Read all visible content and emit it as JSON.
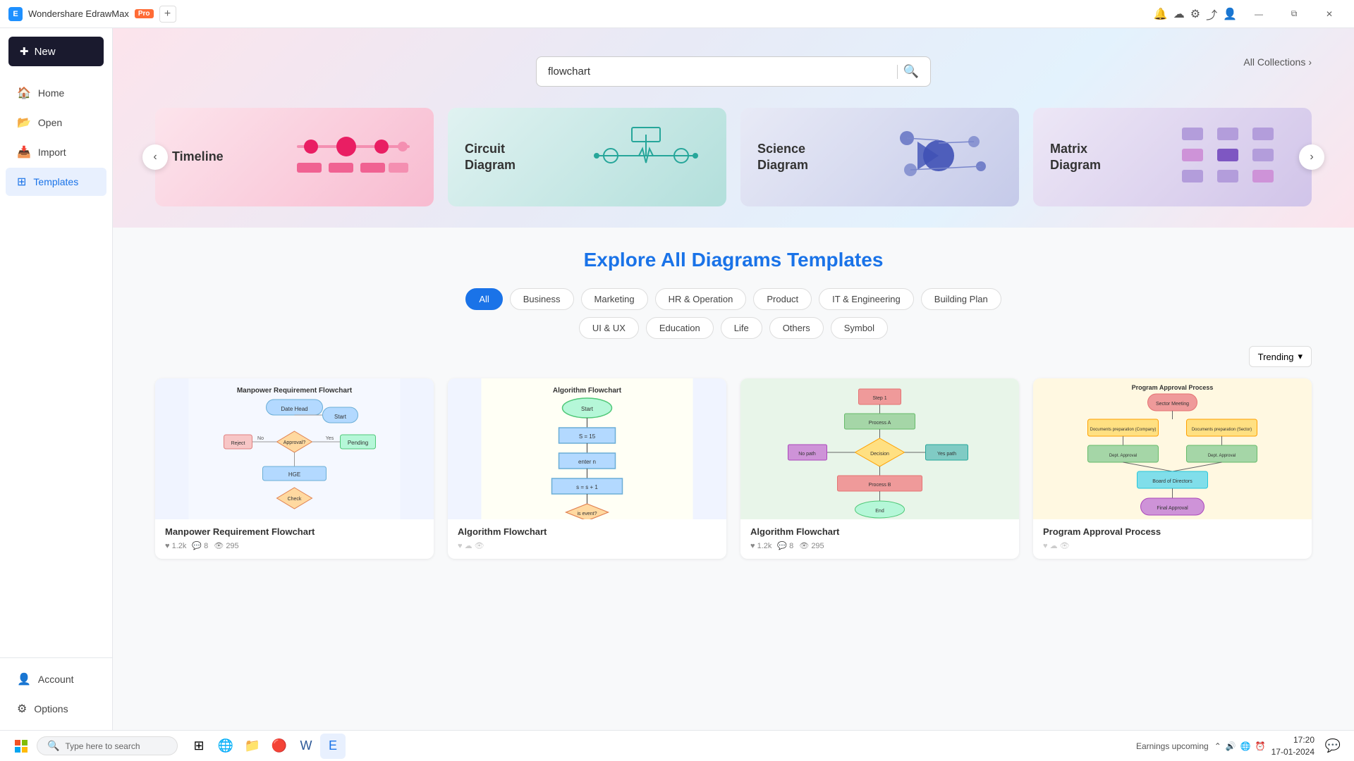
{
  "titleBar": {
    "appName": "Wondershare EdrawMax",
    "proLabel": "Pro",
    "addTabLabel": "+",
    "controls": [
      "—",
      "⧉",
      "✕"
    ]
  },
  "sidebar": {
    "newButton": "New",
    "items": [
      {
        "id": "home",
        "icon": "🏠",
        "label": "Home"
      },
      {
        "id": "open",
        "icon": "📂",
        "label": "Open"
      },
      {
        "id": "import",
        "icon": "📥",
        "label": "Import"
      },
      {
        "id": "templates",
        "icon": "⊞",
        "label": "Templates",
        "active": true
      }
    ],
    "bottomItems": [
      {
        "id": "account",
        "icon": "👤",
        "label": "Account"
      },
      {
        "id": "options",
        "icon": "⚙",
        "label": "Options"
      }
    ]
  },
  "hero": {
    "searchPlaceholder": "flowchart",
    "allCollections": "All Collections",
    "carouselCards": [
      {
        "id": "timeline",
        "label": "Timeline",
        "color": "pink"
      },
      {
        "id": "circuit",
        "label": "Circuit Diagram",
        "color": "teal"
      },
      {
        "id": "science",
        "label": "Science Diagram",
        "color": "indigo"
      },
      {
        "id": "matrix",
        "label": "Matrix Diagram",
        "color": "purple"
      }
    ]
  },
  "explore": {
    "titlePrefix": "Explore",
    "titleHighlight": "All Diagrams Templates",
    "filters": [
      {
        "id": "all",
        "label": "All",
        "active": true
      },
      {
        "id": "business",
        "label": "Business"
      },
      {
        "id": "marketing",
        "label": "Marketing"
      },
      {
        "id": "hr",
        "label": "HR & Operation"
      },
      {
        "id": "product",
        "label": "Product"
      },
      {
        "id": "it",
        "label": "IT & Engineering"
      },
      {
        "id": "building",
        "label": "Building Plan"
      },
      {
        "id": "ui",
        "label": "UI & UX"
      },
      {
        "id": "education",
        "label": "Education"
      },
      {
        "id": "life",
        "label": "Life"
      },
      {
        "id": "others",
        "label": "Others"
      },
      {
        "id": "symbol",
        "label": "Symbol"
      }
    ],
    "sortLabel": "Trending",
    "sortIcon": "▾",
    "templates": [
      {
        "id": "manpower",
        "title": "Manpower Requirement Flowchart",
        "likes": "1.2k",
        "comments": "8",
        "views": "295"
      },
      {
        "id": "algorithm",
        "title": "Algorithm Flowchart",
        "likes": "",
        "comments": "",
        "views": ""
      },
      {
        "id": "algorithm2",
        "title": "Algorithm Flowchart",
        "likes": "1.2k",
        "comments": "8",
        "views": "295"
      },
      {
        "id": "approval",
        "title": "Program Approval Process",
        "likes": "",
        "comments": "",
        "views": ""
      }
    ]
  },
  "taskbar": {
    "searchPlaceholder": "Type here to search",
    "earningsUpcoming": "Earnings upcoming",
    "time": "17:20",
    "date": "17-01-2024"
  }
}
